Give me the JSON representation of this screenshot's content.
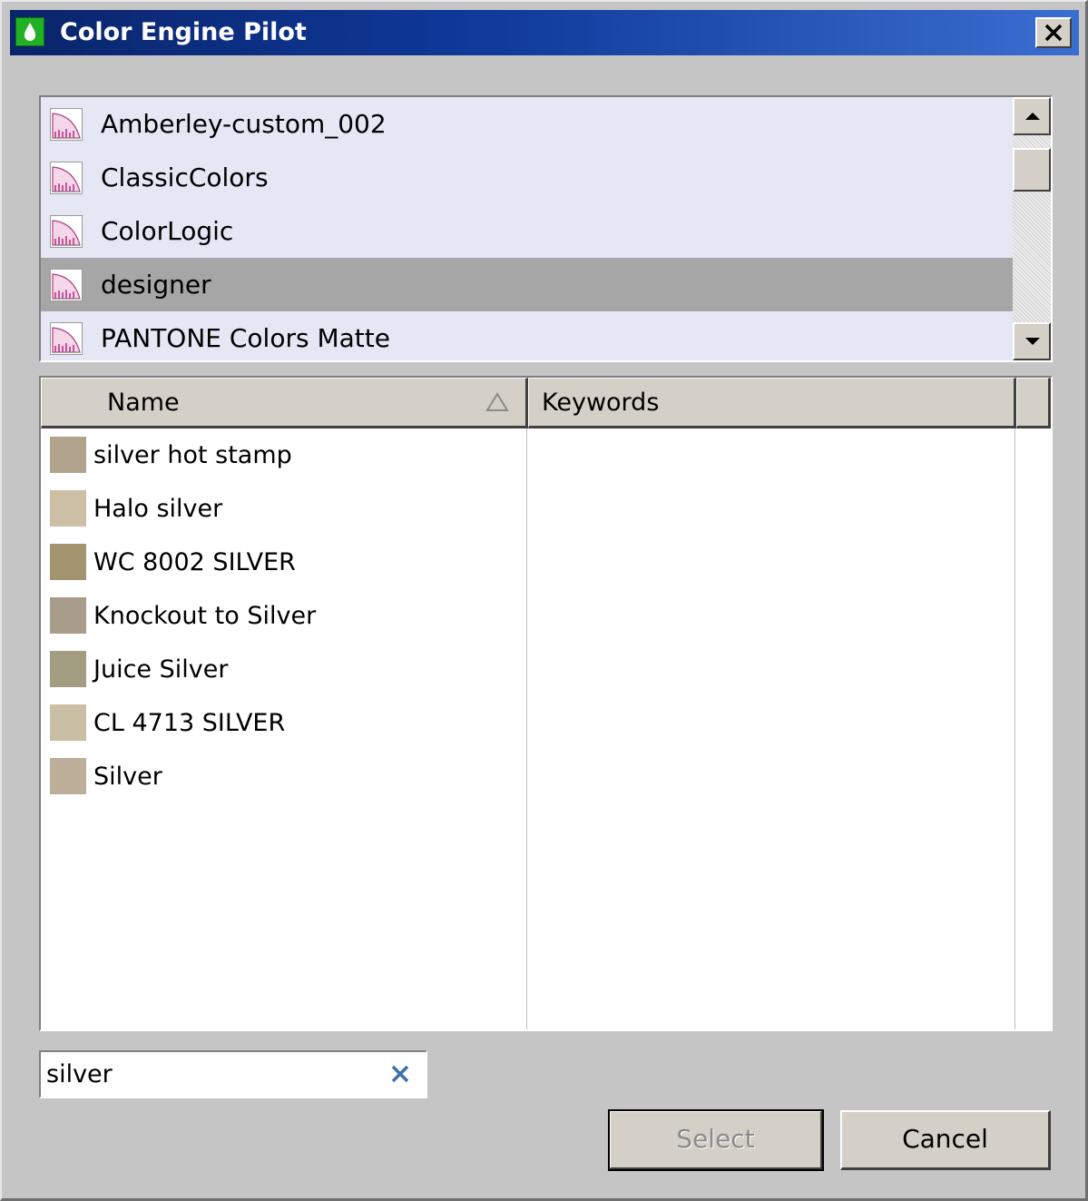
{
  "window": {
    "title": "Color Engine Pilot"
  },
  "libraries": {
    "items": [
      {
        "label": "Amberley-custom_002"
      },
      {
        "label": "ClassicColors"
      },
      {
        "label": "ColorLogic"
      },
      {
        "label": "designer",
        "selected": true
      },
      {
        "label": "PANTONE Colors Matte"
      }
    ]
  },
  "table": {
    "columns": {
      "name": "Name",
      "keywords": "Keywords"
    },
    "sort": "ascending",
    "rows": [
      {
        "name": "silver hot stamp",
        "color": "#b1a38c",
        "keywords": ""
      },
      {
        "name": "Halo silver",
        "color": "#cdbfa6",
        "keywords": ""
      },
      {
        "name": "WC 8002 SILVER",
        "color": "#a2946f",
        "keywords": ""
      },
      {
        "name": "Knockout to Silver",
        "color": "#a89d8a",
        "keywords": ""
      },
      {
        "name": "Juice Silver",
        "color": "#a29d80",
        "keywords": ""
      },
      {
        "name": "CL 4713 SILVER",
        "color": "#c8bfa5",
        "keywords": ""
      },
      {
        "name": "Silver",
        "color": "#bcae99",
        "keywords": ""
      }
    ]
  },
  "search": {
    "value": "silver"
  },
  "buttons": {
    "select": "Select",
    "cancel": "Cancel"
  },
  "icons": {
    "app": "drop-icon",
    "close": "close-icon",
    "library": "color-gamut-icon",
    "sort": "sort-ascending-icon",
    "clear": "clear-icon",
    "scroll_up": "arrow-up-icon",
    "scroll_down": "arrow-down-icon"
  }
}
